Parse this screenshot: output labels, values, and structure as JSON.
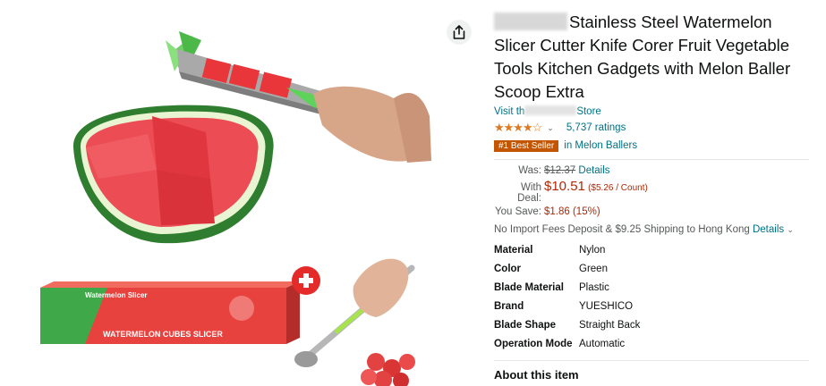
{
  "product": {
    "title": "Stainless Steel Watermelon Slicer Cutter Knife Corer Fruit Vegetable Tools Kitchen Gadgets with Melon Baller Scoop Extra",
    "store_prefix": "Visit th",
    "store_suffix": "Store",
    "rating_count": "5,737 ratings",
    "stars": "★★★★☆",
    "badge": "#1 Best Seller",
    "badge_category": "in Melon Ballers"
  },
  "pricing": {
    "was_label": "Was:",
    "was_price": "$12.37",
    "details_link": "Details",
    "deal_label": "With Deal:",
    "deal_price": "$10.51",
    "per_unit": "($5.26 / Count)",
    "save_label": "You Save:",
    "save_value": "$1.86 (15%)"
  },
  "shipping": {
    "text": "No Import Fees Deposit & $9.25 Shipping to Hong Kong",
    "link": "Details"
  },
  "specs": [
    {
      "key": "Material",
      "value": "Nylon"
    },
    {
      "key": "Color",
      "value": "Green"
    },
    {
      "key": "Blade Material",
      "value": "Plastic"
    },
    {
      "key": "Brand",
      "value": "YUESHICO"
    },
    {
      "key": "Blade Shape",
      "value": "Straight Back"
    },
    {
      "key": "Operation Mode",
      "value": "Automatic"
    }
  ],
  "about_heading": "About this item",
  "box": {
    "top_label": "Watermelon Slicer",
    "bottom_label": "WATERMELON CUBES SLICER"
  },
  "icons": {
    "share": "share-icon",
    "plus": "plus-icon"
  },
  "colors": {
    "link": "#007185",
    "price": "#B12704",
    "badge": "#C45500",
    "star": "#DE7921"
  }
}
